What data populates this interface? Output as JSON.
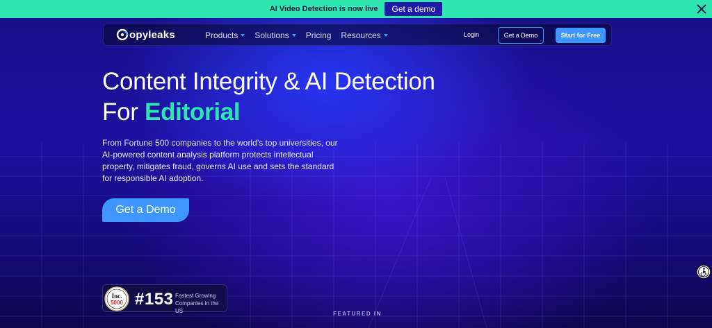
{
  "banner": {
    "text": "AI Video Detection is now live",
    "button": "Get a demo"
  },
  "nav": {
    "logo": "opyleaks",
    "links": [
      "Products",
      "Solutions",
      "Pricing",
      "Resources"
    ],
    "login": "Login",
    "demo": "Get a Demo",
    "start": "Start for Free"
  },
  "hero": {
    "line1": "Content Integrity & AI Detection",
    "line2_prefix": "For ",
    "line2_accent": "Editorial",
    "description": "From Fortune 500 companies to the world’s top universities, our AI-powered content analysis platform protects intellectual property, mitigates fraud, governs AI use and sets the standard for responsible AI adoption.",
    "cta": "Get a Demo"
  },
  "badge": {
    "inc_top": "Inc.",
    "inc_num": "5000",
    "rank": "#153",
    "subtitle": "Fastest Growing Companies in the US"
  },
  "featured": "FEATURED IN",
  "icons": [
    "close-icon",
    "copyleaks-logo-icon",
    "chevron-down-icon",
    "inc-5000-seal-icon",
    "accessibility-icon"
  ],
  "colors": {
    "banner": "#2ee6b0",
    "accent": "#2ee6b0",
    "primary": "#3f96ff",
    "banner_button": "#1f1aa8"
  }
}
